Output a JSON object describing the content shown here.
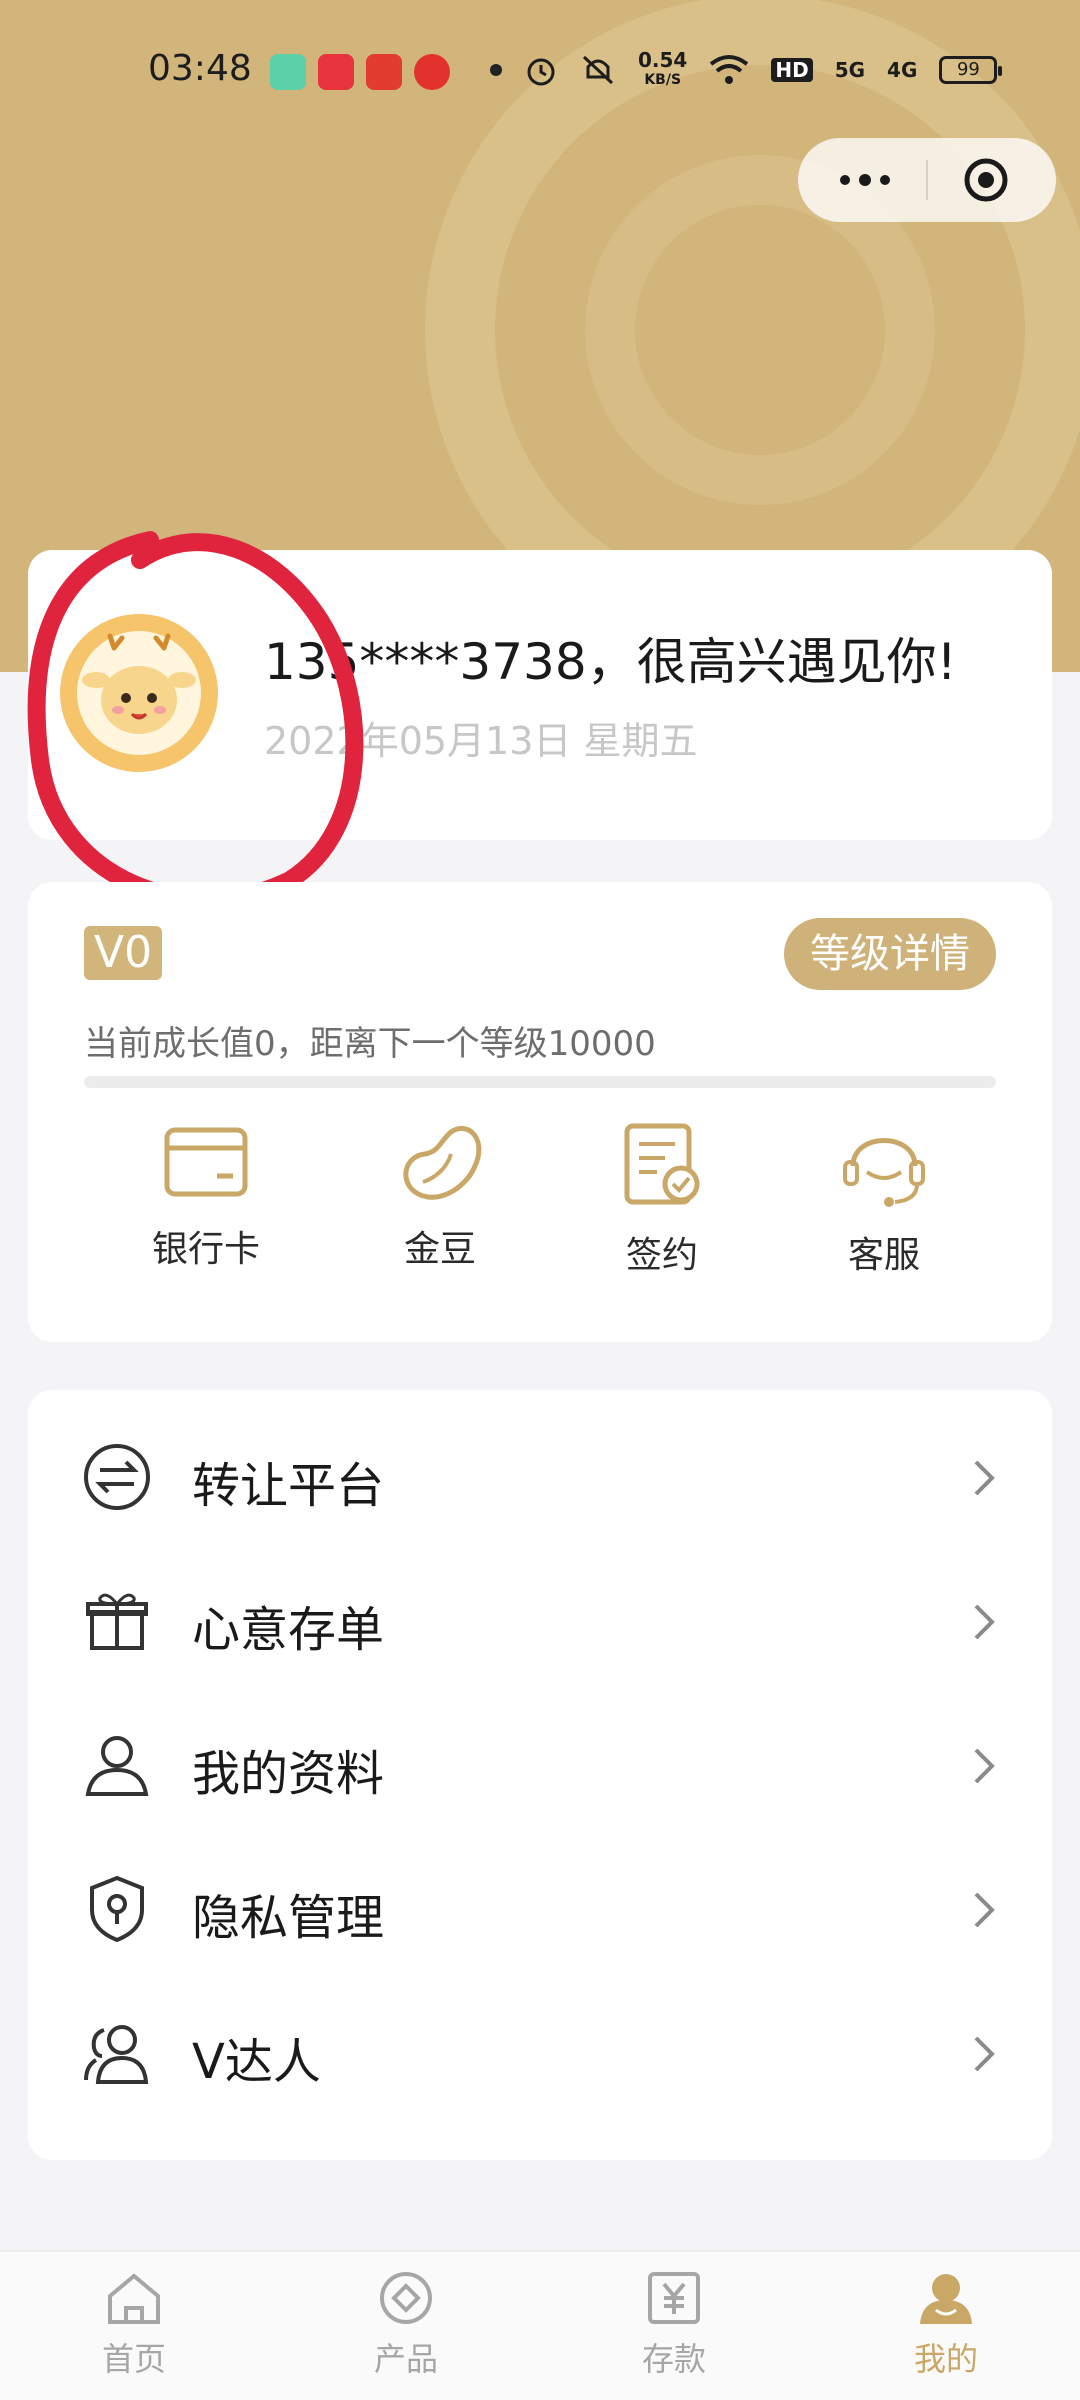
{
  "status_bar": {
    "time": "03:48",
    "network_speed": "0.54",
    "network_unit": "KB/S",
    "hd_label": "HD",
    "signal_1": "5G",
    "signal_2": "4G",
    "battery": "99"
  },
  "profile": {
    "greeting": "135****3738，很高兴遇见你!",
    "date": "2022年05月13日 星期五"
  },
  "level": {
    "badge": "V0",
    "detail_button": "等级详情",
    "growth_text": "当前成长值0，距离下一个等级10000",
    "progress_fraction": 0
  },
  "shortcuts": [
    {
      "label": "银行卡",
      "icon": "bank-card-icon"
    },
    {
      "label": "金豆",
      "icon": "bean-icon"
    },
    {
      "label": "签约",
      "icon": "contract-icon"
    },
    {
      "label": "客服",
      "icon": "customer-service-icon"
    }
  ],
  "menu": [
    {
      "label": "转让平台",
      "icon": "transfer-icon"
    },
    {
      "label": "心意存单",
      "icon": "gift-icon"
    },
    {
      "label": "我的资料",
      "icon": "user-icon"
    },
    {
      "label": "隐私管理",
      "icon": "shield-icon"
    },
    {
      "label": "V达人",
      "icon": "users-icon"
    }
  ],
  "bottom_nav": [
    {
      "label": "首页",
      "icon": "home-icon",
      "active": false
    },
    {
      "label": "产品",
      "icon": "product-icon",
      "active": false
    },
    {
      "label": "存款",
      "icon": "deposit-icon",
      "active": false
    },
    {
      "label": "我的",
      "icon": "profile-icon",
      "active": true
    }
  ],
  "colors": {
    "header": "#d2b57b",
    "accent": "#cfb27a",
    "active_nav": "#c9a766",
    "annotation": "#e0243e"
  }
}
